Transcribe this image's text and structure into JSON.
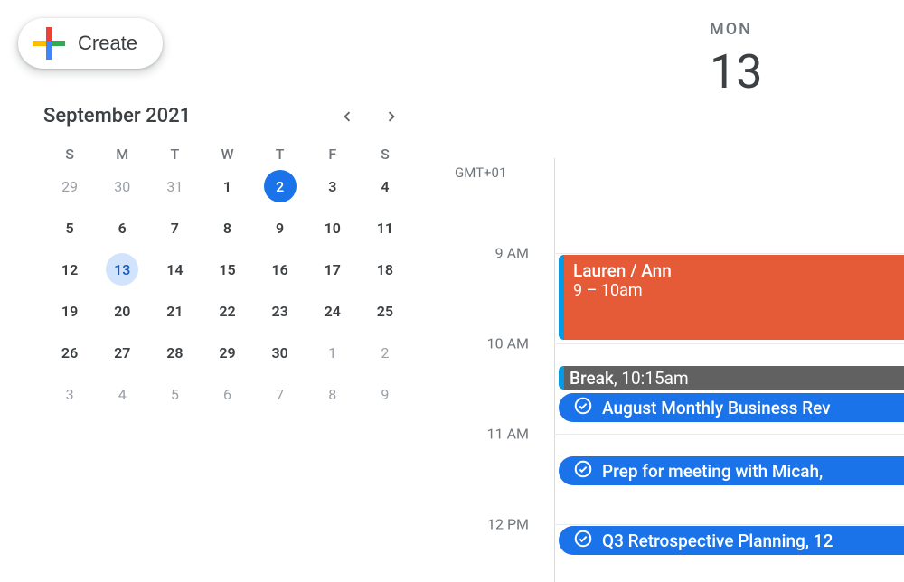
{
  "create_button": {
    "label": "Create"
  },
  "mini_calendar": {
    "title": "September 2021",
    "weekdays": [
      "S",
      "M",
      "T",
      "W",
      "T",
      "F",
      "S"
    ],
    "days": [
      {
        "n": "29",
        "cls": "other-month"
      },
      {
        "n": "30",
        "cls": "other-month"
      },
      {
        "n": "31",
        "cls": "other-month"
      },
      {
        "n": "1",
        "cls": "current-month"
      },
      {
        "n": "2",
        "cls": "today"
      },
      {
        "n": "3",
        "cls": "current-month"
      },
      {
        "n": "4",
        "cls": "current-month"
      },
      {
        "n": "5",
        "cls": "current-month"
      },
      {
        "n": "6",
        "cls": "current-month"
      },
      {
        "n": "7",
        "cls": "current-month"
      },
      {
        "n": "8",
        "cls": "current-month"
      },
      {
        "n": "9",
        "cls": "current-month"
      },
      {
        "n": "10",
        "cls": "current-month"
      },
      {
        "n": "11",
        "cls": "current-month"
      },
      {
        "n": "12",
        "cls": "current-month"
      },
      {
        "n": "13",
        "cls": "selected"
      },
      {
        "n": "14",
        "cls": "current-month"
      },
      {
        "n": "15",
        "cls": "current-month"
      },
      {
        "n": "16",
        "cls": "current-month"
      },
      {
        "n": "17",
        "cls": "current-month"
      },
      {
        "n": "18",
        "cls": "current-month"
      },
      {
        "n": "19",
        "cls": "current-month"
      },
      {
        "n": "20",
        "cls": "current-month"
      },
      {
        "n": "21",
        "cls": "current-month"
      },
      {
        "n": "22",
        "cls": "current-month"
      },
      {
        "n": "23",
        "cls": "current-month"
      },
      {
        "n": "24",
        "cls": "current-month"
      },
      {
        "n": "25",
        "cls": "current-month"
      },
      {
        "n": "26",
        "cls": "current-month"
      },
      {
        "n": "27",
        "cls": "current-month"
      },
      {
        "n": "28",
        "cls": "current-month"
      },
      {
        "n": "29",
        "cls": "current-month"
      },
      {
        "n": "30",
        "cls": "current-month"
      },
      {
        "n": "1",
        "cls": "other-month"
      },
      {
        "n": "2",
        "cls": "other-month"
      },
      {
        "n": "3",
        "cls": "other-month"
      },
      {
        "n": "4",
        "cls": "other-month"
      },
      {
        "n": "5",
        "cls": "other-month"
      },
      {
        "n": "6",
        "cls": "other-month"
      },
      {
        "n": "7",
        "cls": "other-month"
      },
      {
        "n": "8",
        "cls": "other-month"
      },
      {
        "n": "9",
        "cls": "other-month"
      }
    ]
  },
  "day_header": {
    "dow": "MON",
    "dom": "13"
  },
  "timezone": "GMT+01",
  "time_labels": [
    "9 AM",
    "10 AM",
    "11 AM",
    "12 PM"
  ],
  "events": {
    "lauren_ann": {
      "title": "Lauren / Ann",
      "time": "9 – 10am",
      "color": "#e55a37",
      "bar": "#039be5"
    },
    "break": {
      "title": "Break",
      "time": "10:15am",
      "text": "Break, 10:15am",
      "bg": "#616161",
      "bar": "#039be5"
    },
    "august_review": {
      "title": "August Monthly Business Rev",
      "color": "#1a73e8"
    },
    "prep_micah": {
      "title": "Prep for meeting with Micah,",
      "color": "#1a73e8"
    },
    "q3_retro": {
      "title": "Q3 Retrospective Planning, 12",
      "color": "#1a73e8"
    }
  }
}
